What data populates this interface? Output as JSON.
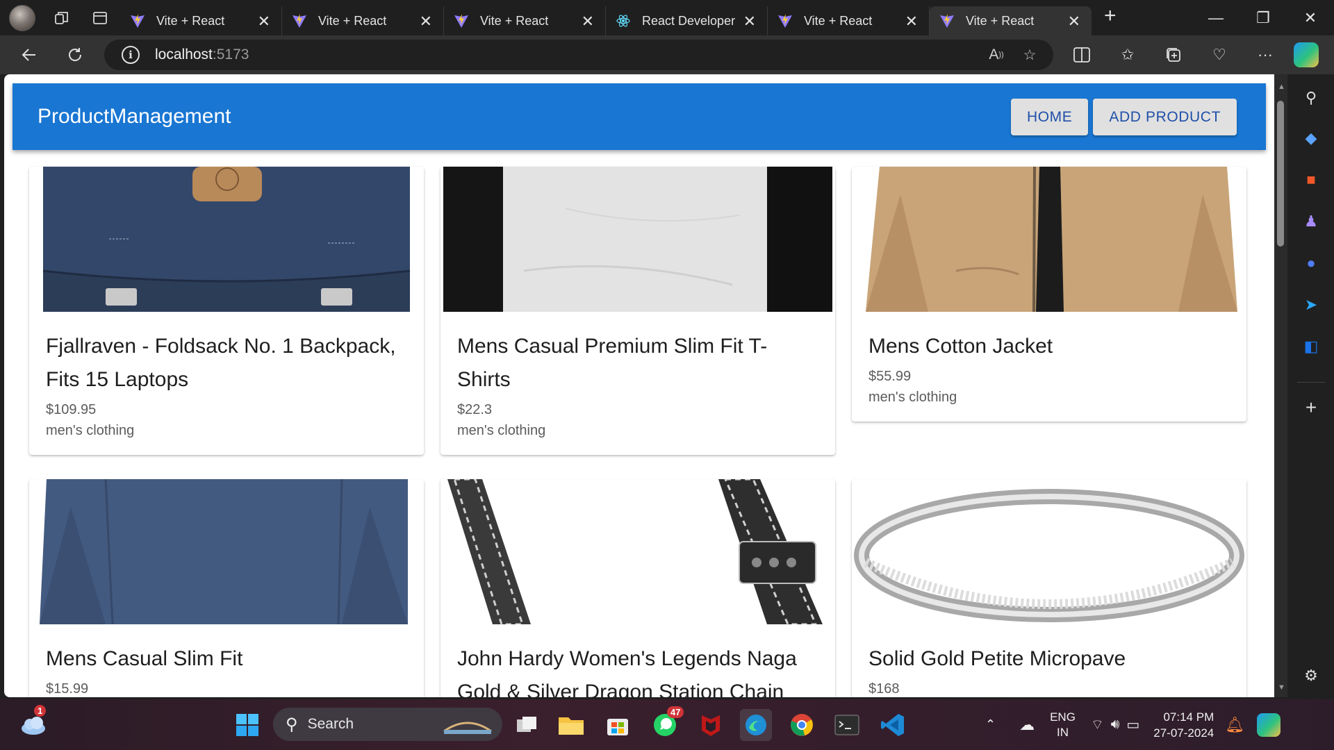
{
  "browser": {
    "tabs": [
      {
        "title": "Vite + React",
        "icon": "vite-icon",
        "active": false
      },
      {
        "title": "Vite + React",
        "icon": "vite-icon",
        "active": false
      },
      {
        "title": "Vite + React",
        "icon": "vite-icon",
        "active": false
      },
      {
        "title": "React Developer",
        "icon": "react-icon",
        "active": false
      },
      {
        "title": "Vite + React",
        "icon": "vite-icon",
        "active": false
      },
      {
        "title": "Vite + React",
        "icon": "vite-icon",
        "active": true
      }
    ],
    "url_host": "localhost",
    "url_port": ":5173"
  },
  "app": {
    "brand": "ProductManagement",
    "nav": {
      "home": "HOME",
      "add_product": "ADD PRODUCT"
    },
    "colors": {
      "appbar": "#1976d2",
      "nav_button_bg": "#e0e0e0",
      "nav_button_text": "#1f4fa8"
    },
    "products": [
      {
        "title": "Fjallraven - Foldsack No. 1 Backpack, Fits 15 Laptops",
        "price": "$109.95",
        "category": "men's clothing"
      },
      {
        "title": "Mens Casual Premium Slim Fit T-Shirts",
        "price": "$22.3",
        "category": "men's clothing"
      },
      {
        "title": "Mens Cotton Jacket",
        "price": "$55.99",
        "category": "men's clothing"
      },
      {
        "title": "Mens Casual Slim Fit",
        "price": "$15.99",
        "category": ""
      },
      {
        "title": "John Hardy Women's Legends Naga Gold & Silver Dragon Station Chain",
        "price": "",
        "category": ""
      },
      {
        "title": "Solid Gold Petite Micropave",
        "price": "$168",
        "category": ""
      }
    ]
  },
  "taskbar": {
    "search_label": "Search",
    "weather_badge": "1",
    "whatsapp_badge": "47",
    "lang_line1": "ENG",
    "lang_line2": "IN",
    "time": "07:14 PM",
    "date": "27-07-2024"
  }
}
